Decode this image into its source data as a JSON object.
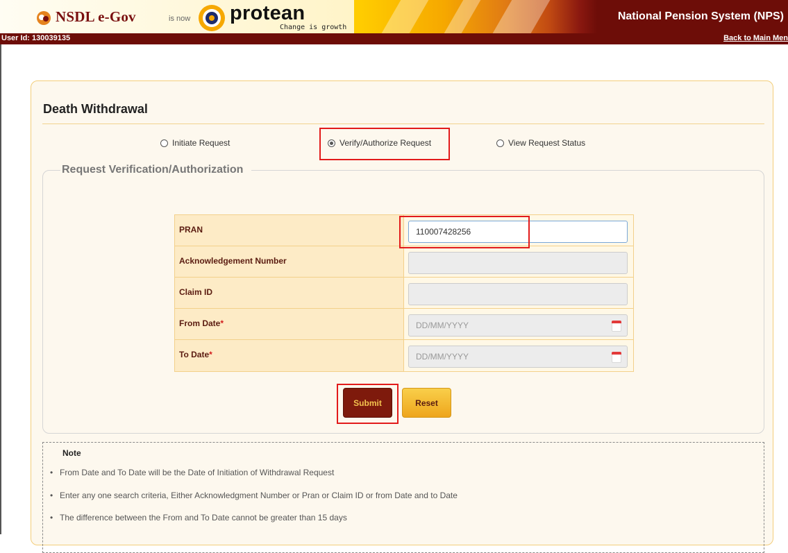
{
  "header": {
    "brand_nsdl": "NSDL e-Gov",
    "is_now": "is now",
    "brand_protean": "protean",
    "tagline": "Change is growth",
    "system_title": "National Pension System (NPS)",
    "user_id": "User Id: 130039135",
    "back_link": "Back to Main Men"
  },
  "page": {
    "title": "Death Withdrawal",
    "radios": [
      {
        "label": "Initiate Request",
        "checked": false
      },
      {
        "label": "Verify/Authorize Request",
        "checked": true
      },
      {
        "label": "View Request Status",
        "checked": false
      }
    ],
    "section_legend": "Request Verification/Authorization"
  },
  "form": {
    "fields": [
      {
        "label": "PRAN",
        "value": "110007428256",
        "required": false
      },
      {
        "label": "Acknowledgement Number",
        "value": "",
        "required": false
      },
      {
        "label": "Claim ID",
        "value": "",
        "required": false
      },
      {
        "label": "From Date",
        "placeholder": "DD/MM/YYYY",
        "required": true
      },
      {
        "label": "To Date",
        "placeholder": "DD/MM/YYYY",
        "required": true
      }
    ],
    "required_mark": "*",
    "submit_label": "Submit",
    "reset_label": "Reset"
  },
  "note": {
    "title": "Note",
    "bullet": "•",
    "items": [
      "From Date and To Date will be the Date of Initiation of Withdrawal Request",
      "Enter any one search criteria, Either Acknowledgment Number or Pran or Claim ID or from Date and to Date",
      "The difference between the From and To Date cannot be greater than 15 days"
    ]
  },
  "colors": {
    "header_dark": "#6d0d08",
    "accent_yellow": "#ffcc00",
    "submit_bg": "#7e1a0c",
    "highlight_red": "#e21a1a"
  }
}
